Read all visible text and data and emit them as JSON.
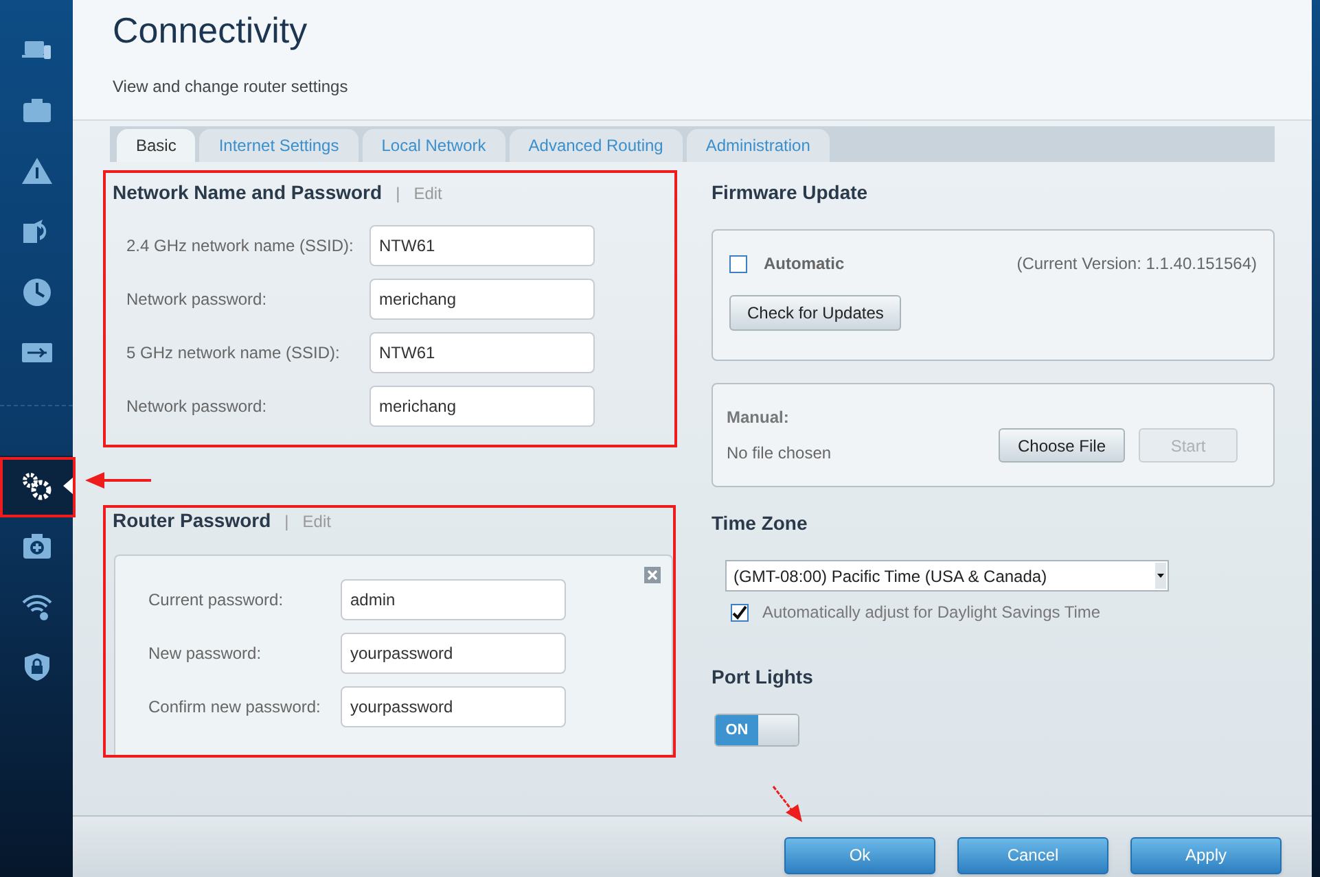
{
  "page": {
    "title": "Connectivity",
    "subtitle": "View and change router settings"
  },
  "sidebar": {
    "groups": [
      [
        {
          "selected": false
        },
        {
          "selected": false
        },
        {
          "selected": false
        },
        {
          "selected": false
        },
        {
          "selected": false
        },
        {
          "selected": false
        }
      ],
      [
        {
          "selected": true
        },
        {
          "selected": false
        },
        {
          "selected": false
        },
        {
          "selected": false
        }
      ]
    ]
  },
  "tabs": [
    {
      "label": "Basic",
      "selected": true
    },
    {
      "label": "Internet Settings",
      "selected": false
    },
    {
      "label": "Local Network",
      "selected": false
    },
    {
      "label": "Advanced Routing",
      "selected": false
    },
    {
      "label": "Administration",
      "selected": false
    }
  ],
  "network": {
    "title": "Network Name and Password",
    "separator": "|",
    "edit": "Edit",
    "fields": [
      {
        "label": "2.4 GHz network name (SSID):",
        "value": "NTW61"
      },
      {
        "label": "Network password:",
        "value": "merichang"
      },
      {
        "label": "5 GHz network name (SSID):",
        "value": "NTW61"
      },
      {
        "label": "Network password:",
        "value": "merichang"
      }
    ]
  },
  "router_password": {
    "title": "Router Password",
    "separator": "|",
    "edit": "Edit",
    "fields": [
      {
        "label": "Current password:",
        "value": "admin"
      },
      {
        "label": "New password:",
        "value": "yourpassword"
      },
      {
        "label": "Confirm new password:",
        "value": "yourpassword"
      }
    ]
  },
  "firmware": {
    "title": "Firmware Update",
    "automatic": {
      "label": "Automatic",
      "checked": false
    },
    "current_version": "(Current Version: 1.1.40.151564)",
    "check_button": "Check for Updates",
    "manual": {
      "label": "Manual:",
      "file_status": "No file chosen",
      "choose_button": "Choose File",
      "start_button": {
        "label": "Start",
        "disabled": true
      }
    }
  },
  "time_zone": {
    "title": "Time Zone",
    "value": "(GMT-08:00) Pacific Time (USA & Canada)",
    "dst": {
      "label": "Automatically adjust for Daylight Savings Time",
      "checked": true
    }
  },
  "port_lights": {
    "title": "Port Lights",
    "toggle": {
      "label": "ON",
      "on": true
    }
  },
  "footer": {
    "buttons": [
      "Ok",
      "Cancel",
      "Apply"
    ]
  }
}
